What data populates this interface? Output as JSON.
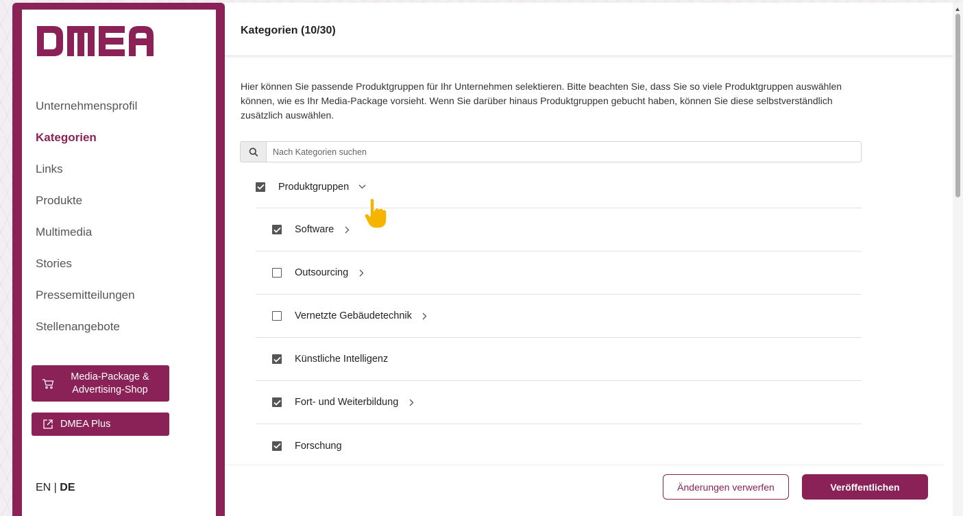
{
  "brand": {
    "logo_text": "DMEA",
    "accent": "#8b2257"
  },
  "sidebar": {
    "items": [
      {
        "label": "Unternehmensprofil",
        "active": false
      },
      {
        "label": "Kategorien",
        "active": true
      },
      {
        "label": "Links",
        "active": false
      },
      {
        "label": "Produkte",
        "active": false
      },
      {
        "label": "Multimedia",
        "active": false
      },
      {
        "label": "Stories",
        "active": false
      },
      {
        "label": "Pressemitteilungen",
        "active": false
      },
      {
        "label": "Stellenangebote",
        "active": false
      }
    ],
    "shop_button": {
      "line1": "Media-Package &",
      "line2": "Advertising-Shop",
      "icon": "cart-icon"
    },
    "plus_button": {
      "label": "DMEA Plus",
      "icon": "external-link-icon"
    },
    "lang": {
      "en": "EN",
      "separator": " | ",
      "de": "DE",
      "active": "DE"
    }
  },
  "header": {
    "title": "Kategorien (10/30)"
  },
  "intro": {
    "text": "Hier können Sie passende Produktgruppen für Ihr Unternehmen selektieren. Bitte beachten Sie, dass Sie so viele Produktgruppen auswählen können, wie es Ihr Media-Package vorsieht. Wenn Sie darüber hinaus Produktgruppen gebucht haben, können Sie diese selbstverständlich zusätzlich auswählen."
  },
  "search": {
    "placeholder": "Nach Kategorien suchen",
    "value": "",
    "icon": "search-icon"
  },
  "tree": {
    "root": {
      "label": "Produktgruppen",
      "checked": true,
      "expanded": true
    },
    "children": [
      {
        "label": "Software",
        "checked": true,
        "has_children": true
      },
      {
        "label": "Outsourcing",
        "checked": false,
        "has_children": true
      },
      {
        "label": "Vernetzte Gebäudetechnik",
        "checked": false,
        "has_children": true
      },
      {
        "label": "Künstliche Intelligenz",
        "checked": true,
        "has_children": false
      },
      {
        "label": "Fort- und Weiterbildung",
        "checked": true,
        "has_children": true
      },
      {
        "label": "Forschung",
        "checked": true,
        "has_children": false
      }
    ]
  },
  "footer": {
    "discard_label": "Änderungen verwerfen",
    "publish_label": "Veröffentlichen"
  }
}
